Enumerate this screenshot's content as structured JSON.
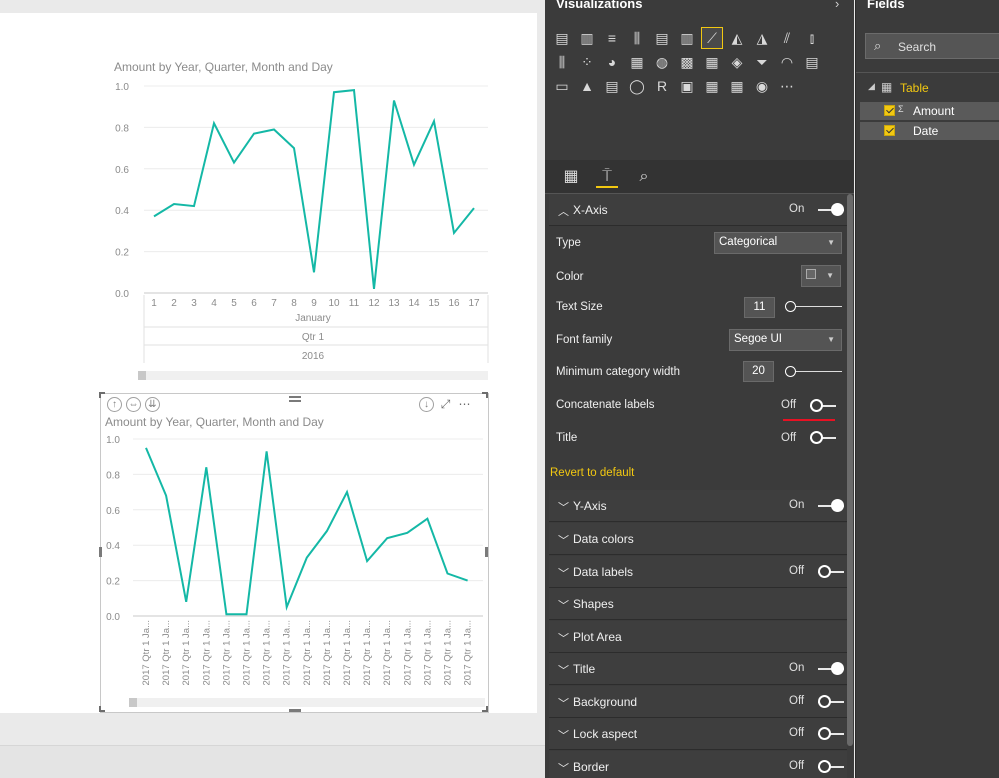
{
  "charts": {
    "chart1": {
      "title": "Amount by Year, Quarter, Month and Day",
      "yticks": [
        "1.0",
        "0.8",
        "0.6",
        "0.4",
        "0.2",
        "0.0"
      ],
      "month_label": "January",
      "quarter_label": "Qtr 1",
      "year_label": "2016"
    },
    "chart2": {
      "title": "Amount by Year, Quarter, Month and Day",
      "yticks": [
        "1.0",
        "0.8",
        "0.6",
        "0.4",
        "0.2",
        "0.0"
      ],
      "xlabel_text": "2017 Qtr 1 Ja..."
    }
  },
  "chart_data": [
    {
      "type": "line",
      "title": "Amount by Year, Quarter, Month and Day",
      "x": [
        1,
        2,
        3,
        4,
        5,
        6,
        7,
        8,
        9,
        10,
        11,
        12,
        13,
        14,
        15,
        16,
        17
      ],
      "series": [
        {
          "values": [
            0.37,
            0.43,
            0.42,
            0.82,
            0.63,
            0.77,
            0.79,
            0.7,
            0.1,
            0.97,
            0.98,
            0.02,
            0.93,
            0.62,
            0.83,
            0.29,
            0.41
          ]
        }
      ],
      "ylim": [
        0,
        1.0
      ],
      "xlabel": "",
      "ylabel": "",
      "color": "#14b8a6",
      "grid": true
    },
    {
      "type": "line",
      "title": "Amount by Year, Quarter, Month and Day",
      "categories": [
        "2017 Qtr 1 Ja...",
        "2017 Qtr 1 Ja...",
        "2017 Qtr 1 Ja...",
        "2017 Qtr 1 Ja...",
        "2017 Qtr 1 Ja...",
        "2017 Qtr 1 Ja...",
        "2017 Qtr 1 Ja...",
        "2017 Qtr 1 Ja...",
        "2017 Qtr 1 Ja...",
        "2017 Qtr 1 Ja...",
        "2017 Qtr 1 Ja...",
        "2017 Qtr 1 Ja...",
        "2017 Qtr 1 Ja...",
        "2017 Qtr 1 Ja...",
        "2017 Qtr 1 Ja...",
        "2017 Qtr 1 Ja...",
        "2017 Qtr 1 Ja..."
      ],
      "series": [
        {
          "values": [
            0.95,
            0.68,
            0.08,
            0.84,
            0.01,
            0.01,
            0.93,
            0.05,
            0.33,
            0.48,
            0.7,
            0.31,
            0.44,
            0.47,
            0.55,
            0.24,
            0.2
          ]
        }
      ],
      "ylim": [
        0,
        1.0
      ],
      "xlabel": "",
      "ylabel": "",
      "color": "#14b8a6",
      "grid": true
    }
  ],
  "visualizations": {
    "title": "Visualizations",
    "collapse_icon": "chevron-right-icon"
  },
  "format": {
    "x_axis": {
      "label": "X-Axis",
      "state": "On"
    },
    "type": {
      "label": "Type",
      "value": "Categorical"
    },
    "color": {
      "label": "Color"
    },
    "text_size": {
      "label": "Text Size",
      "value": "11"
    },
    "font_family": {
      "label": "Font family",
      "value": "Segoe UI"
    },
    "min_cat_width": {
      "label": "Minimum category width",
      "value": "20"
    },
    "concatenate": {
      "label": "Concatenate labels",
      "state": "Off"
    },
    "title_prop": {
      "label": "Title",
      "state": "Off"
    },
    "revert": "Revert to default",
    "cards": [
      {
        "label": "Y-Axis",
        "state": "On"
      },
      {
        "label": "Data colors",
        "state": ""
      },
      {
        "label": "Data labels",
        "state": "Off"
      },
      {
        "label": "Shapes",
        "state": ""
      },
      {
        "label": "Plot Area",
        "state": ""
      },
      {
        "label": "Title",
        "state": "On"
      },
      {
        "label": "Background",
        "state": "Off"
      },
      {
        "label": "Lock aspect",
        "state": "Off"
      },
      {
        "label": "Border",
        "state": "Off"
      }
    ]
  },
  "fields": {
    "title": "Fields",
    "search_placeholder": "Search",
    "table_label": "Table",
    "amount_label": "Amount",
    "date_label": "Date"
  },
  "colors": {
    "accent": "#f2c811",
    "line": "#14b8a6",
    "pane_bg": "#3b3b3b",
    "underline": "#e81123"
  }
}
